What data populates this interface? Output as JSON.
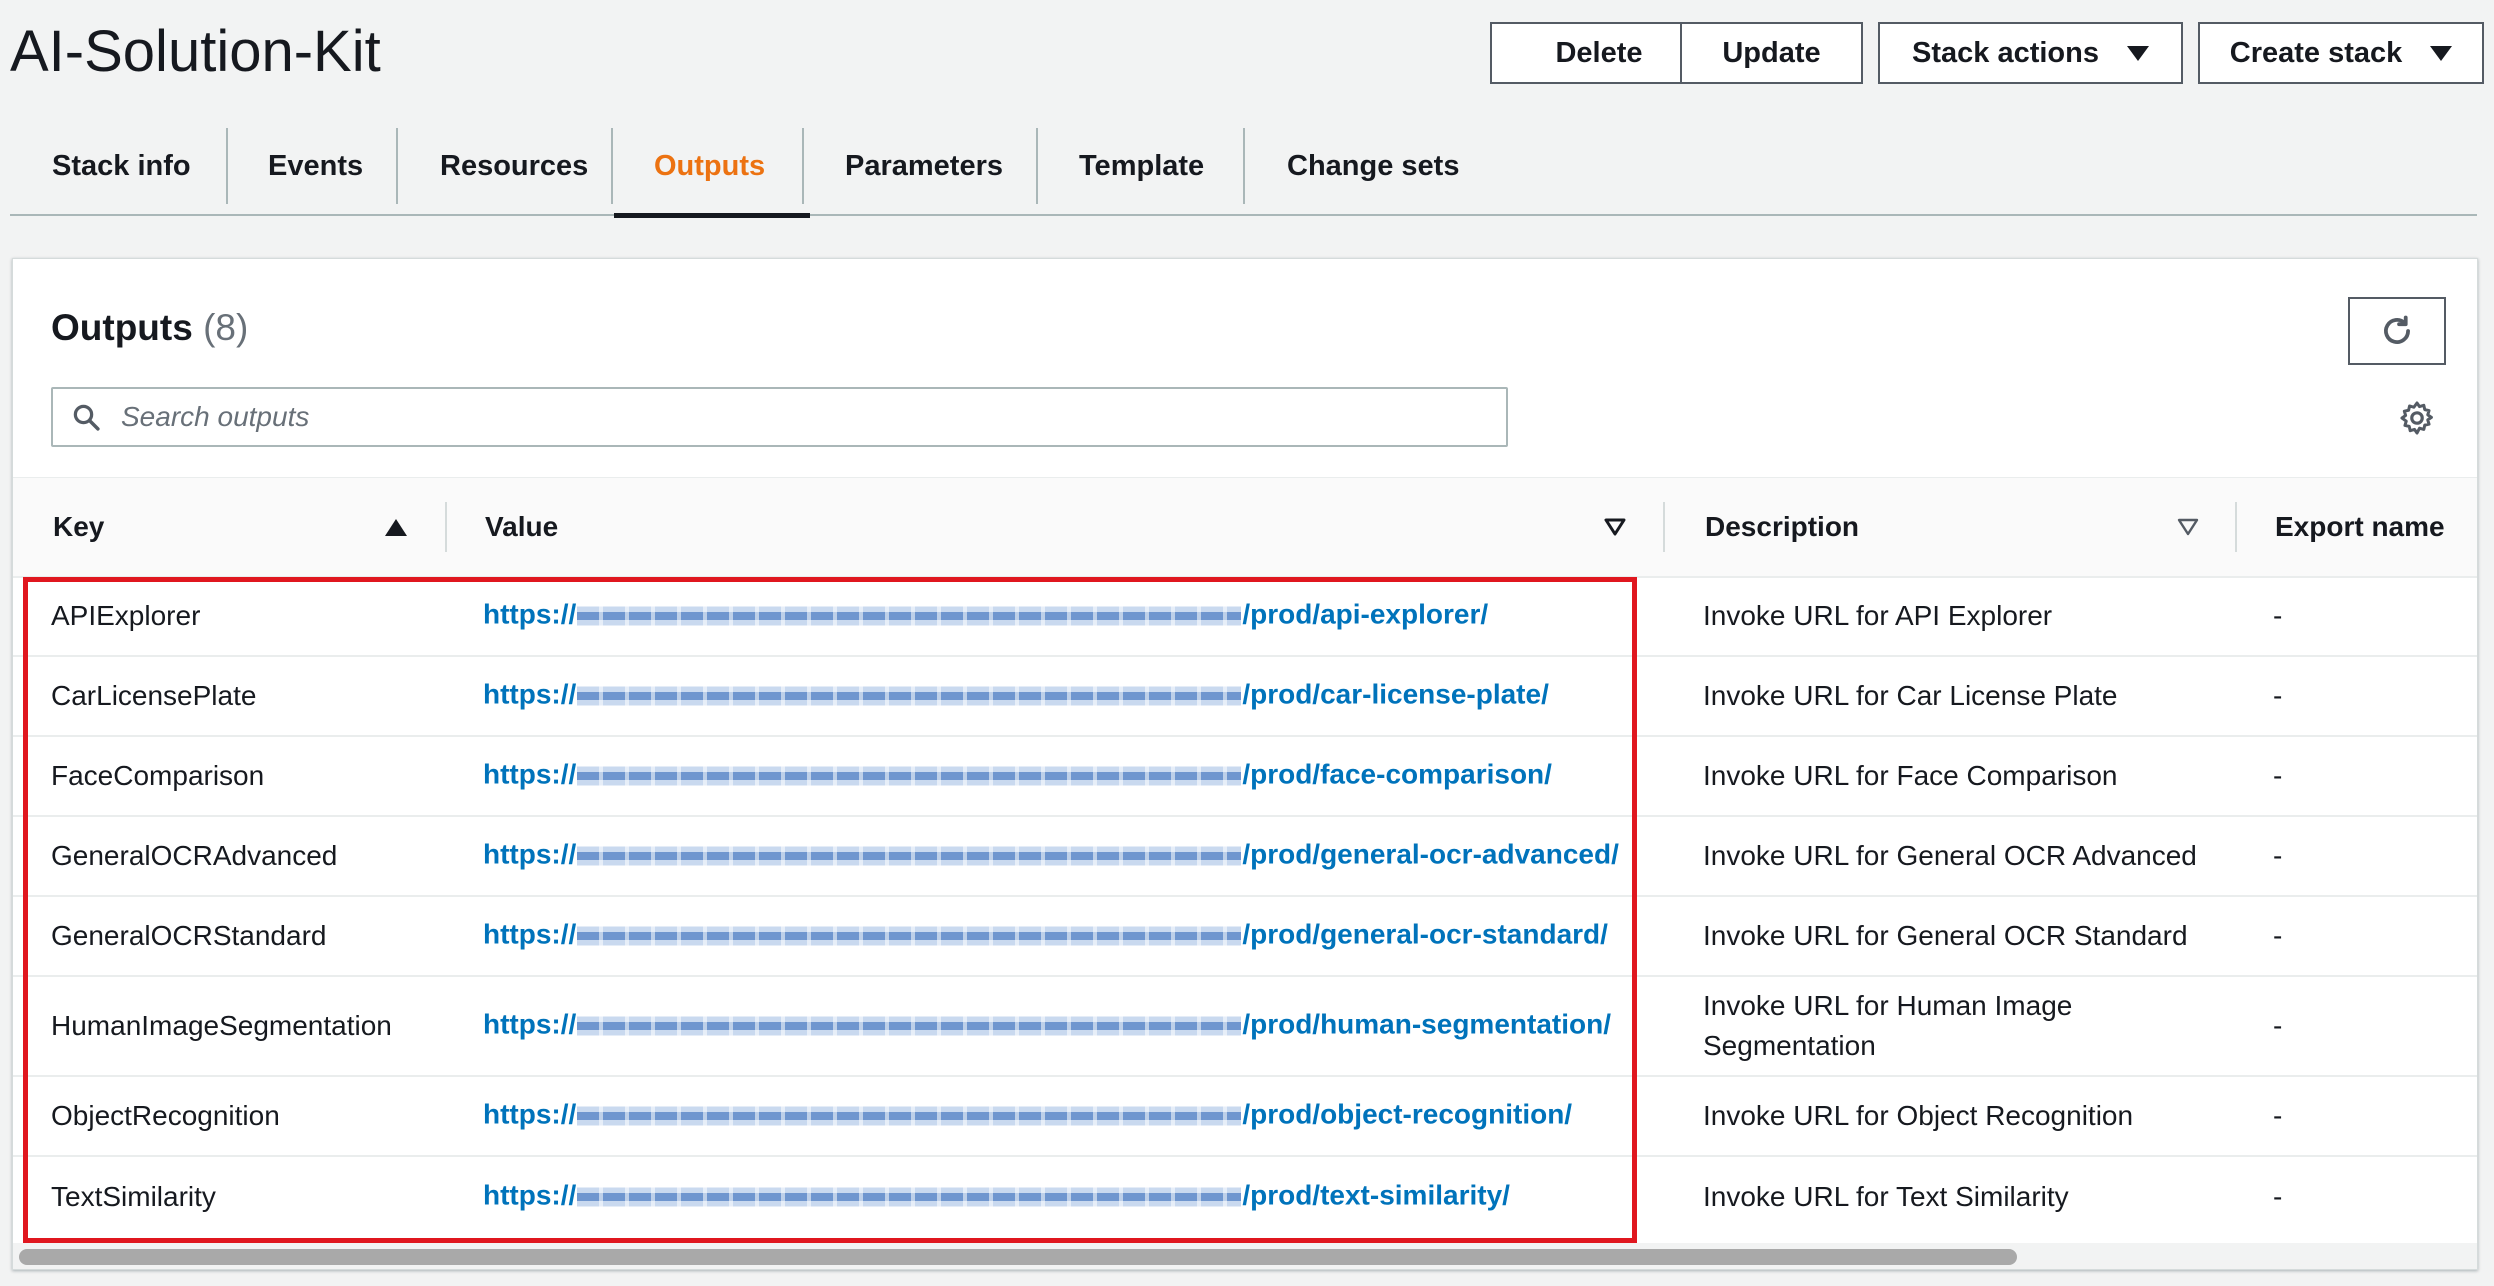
{
  "page": {
    "title": "AI-Solution-Kit"
  },
  "actions": {
    "delete": "Delete",
    "update": "Update",
    "stack_actions": "Stack actions",
    "create_stack": "Create stack"
  },
  "tabs": [
    {
      "label": "Stack info"
    },
    {
      "label": "Events"
    },
    {
      "label": "Resources"
    },
    {
      "label": "Outputs",
      "active": true
    },
    {
      "label": "Parameters"
    },
    {
      "label": "Template"
    },
    {
      "label": "Change sets"
    }
  ],
  "outputs": {
    "title": "Outputs",
    "count": "(8)",
    "search_placeholder": "Search outputs",
    "columns": {
      "key": "Key",
      "value": "Value",
      "description": "Description",
      "export_name": "Export name"
    },
    "rows": [
      {
        "key": "APIExplorer",
        "value_prefix": "https://",
        "value_suffix": "/prod/api-explorer/",
        "description": "Invoke URL for API Explorer",
        "export_name": "-"
      },
      {
        "key": "CarLicensePlate",
        "value_prefix": "https://",
        "value_suffix": "/prod/car-license-plate/",
        "description": "Invoke URL for Car License Plate",
        "export_name": "-"
      },
      {
        "key": "FaceComparison",
        "value_prefix": "https://",
        "value_suffix": "/prod/face-comparison/",
        "description": "Invoke URL for Face Comparison",
        "export_name": "-"
      },
      {
        "key": "GeneralOCRAdvanced",
        "value_prefix": "https://",
        "value_suffix": "/prod/general-ocr-advanced/",
        "description": "Invoke URL for General OCR Advanced",
        "export_name": "-"
      },
      {
        "key": "GeneralOCRStandard",
        "value_prefix": "https://",
        "value_suffix": "/prod/general-ocr-standard/",
        "description": "Invoke URL for General OCR Standard",
        "export_name": "-"
      },
      {
        "key": "HumanImageSegmentation",
        "value_prefix": "https://",
        "value_suffix": "/prod/human-segmentation/",
        "description": "Invoke URL for Human Image Segmentation",
        "export_name": "-"
      },
      {
        "key": "ObjectRecognition",
        "value_prefix": "https://",
        "value_suffix": "/prod/object-recognition/",
        "description": "Invoke URL for Object Recognition",
        "export_name": "-"
      },
      {
        "key": "TextSimilarity",
        "value_prefix": "https://",
        "value_suffix": "/prod/text-similarity/",
        "description": "Invoke URL for Text Similarity",
        "export_name": "-"
      }
    ]
  },
  "colors": {
    "accent": "#ec7211",
    "link": "#0073bb",
    "highlight": "#e0171f"
  },
  "icons": [
    "caret-down-icon",
    "refresh-icon",
    "search-icon",
    "gear-icon",
    "sort-ascending-icon",
    "sort-descending-icon"
  ]
}
